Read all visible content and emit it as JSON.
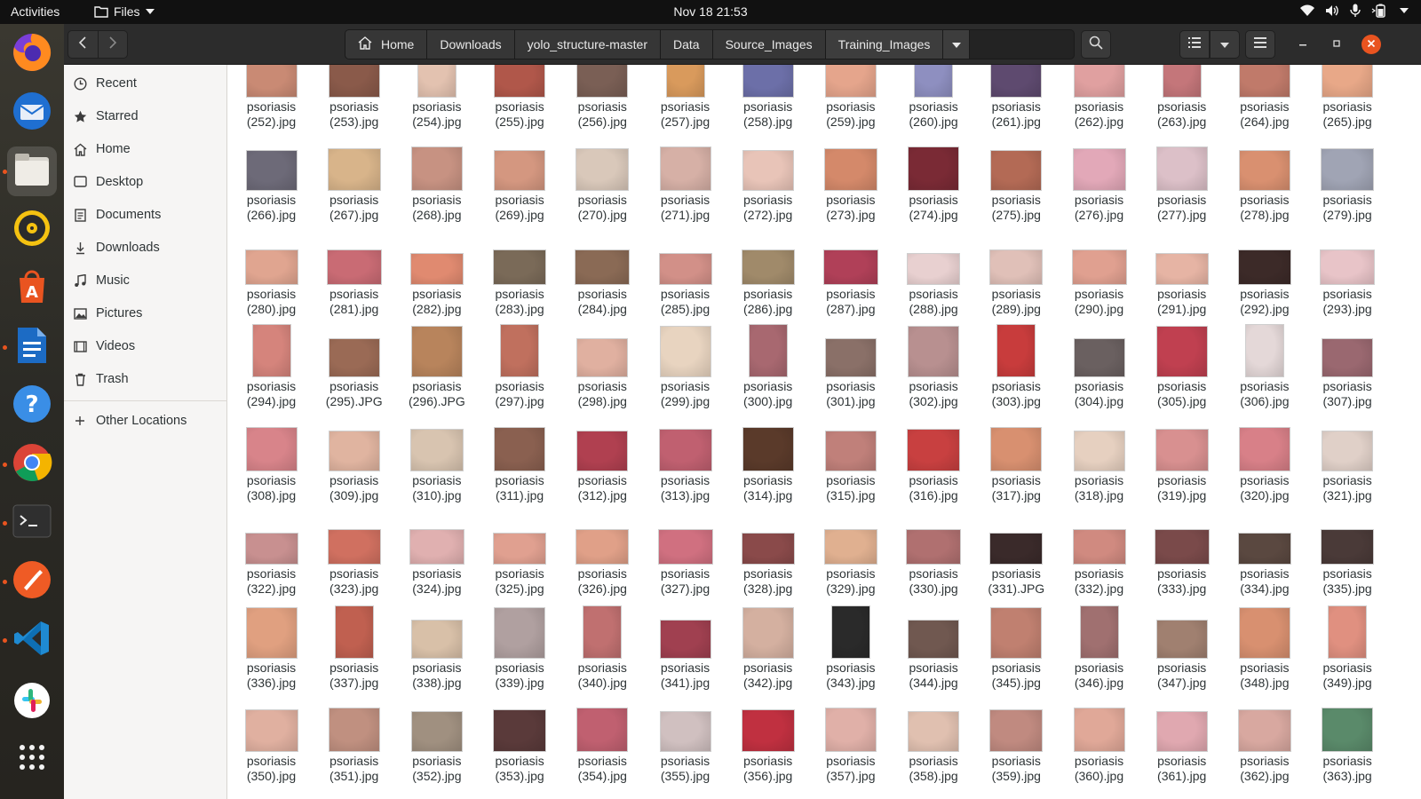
{
  "topbar": {
    "activities": "Activities",
    "app_name": "Files",
    "clock": "Nov 18  21:53"
  },
  "dock": {
    "items": [
      {
        "name": "firefox-icon",
        "running": false
      },
      {
        "name": "thunderbird-icon",
        "running": false
      },
      {
        "name": "files-icon",
        "running": true
      },
      {
        "name": "rhythmbox-icon",
        "running": false
      },
      {
        "name": "software-center-icon",
        "running": false
      },
      {
        "name": "libreoffice-writer-icon",
        "running": true
      },
      {
        "name": "help-icon",
        "running": false
      },
      {
        "name": "chrome-icon",
        "running": true
      },
      {
        "name": "terminal-icon",
        "running": true
      },
      {
        "name": "postman-icon",
        "running": true
      },
      {
        "name": "vscode-icon",
        "running": true
      },
      {
        "name": "slack-icon",
        "running": false
      },
      {
        "name": "show-apps-icon",
        "running": false
      }
    ]
  },
  "pathbar": {
    "home": "Home",
    "crumbs": [
      "Downloads",
      "yolo_structure-master",
      "Data",
      "Source_Images",
      "Training_Images"
    ]
  },
  "sidebar": {
    "items": [
      {
        "label": "Recent",
        "icon": "clock-icon"
      },
      {
        "label": "Starred",
        "icon": "star-icon"
      },
      {
        "label": "Home",
        "icon": "home-icon"
      },
      {
        "label": "Desktop",
        "icon": "desktop-icon"
      },
      {
        "label": "Documents",
        "icon": "documents-icon"
      },
      {
        "label": "Downloads",
        "icon": "downloads-icon"
      },
      {
        "label": "Music",
        "icon": "music-icon"
      },
      {
        "label": "Pictures",
        "icon": "pictures-icon"
      },
      {
        "label": "Videos",
        "icon": "videos-icon"
      },
      {
        "label": "Trash",
        "icon": "trash-icon"
      }
    ],
    "other_locations": "Other Locations"
  },
  "files": {
    "prefix": "psoriasis",
    "rows": [
      [
        "(252).jpg",
        "(253).jpg",
        "(254).jpg",
        "(255).jpg",
        "(256).jpg",
        "(257).jpg",
        "(258).jpg",
        "(259).jpg",
        "(260).jpg",
        "(261).jpg",
        "(262).jpg",
        "(263).jpg",
        "(264).jpg",
        "(265).jpg"
      ],
      [
        "(266).jpg",
        "(267).jpg",
        "(268).jpg",
        "(269).jpg",
        "(270).jpg",
        "(271).jpg",
        "(272).jpg",
        "(273).jpg",
        "(274).jpg",
        "(275).jpg",
        "(276).jpg",
        "(277).jpg",
        "(278).jpg",
        "(279).jpg"
      ],
      [
        "(280).jpg",
        "(281).jpg",
        "(282).jpg",
        "(283).jpg",
        "(284).jpg",
        "(285).jpg",
        "(286).jpg",
        "(287).jpg",
        "(288).jpg",
        "(289).jpg",
        "(290).jpg",
        "(291).jpg",
        "(292).jpg",
        "(293).jpg"
      ],
      [
        "(294).jpg",
        "(295).JPG",
        "(296).JPG",
        "(297).jpg",
        "(298).jpg",
        "(299).jpg",
        "(300).jpg",
        "(301).jpg",
        "(302).jpg",
        "(303).jpg",
        "(304).jpg",
        "(305).jpg",
        "(306).jpg",
        "(307).jpg"
      ],
      [
        "(308).jpg",
        "(309).jpg",
        "(310).jpg",
        "(311).jpg",
        "(312).jpg",
        "(313).jpg",
        "(314).jpg",
        "(315).jpg",
        "(316).jpg",
        "(317).jpg",
        "(318).jpg",
        "(319).jpg",
        "(320).jpg",
        "(321).jpg"
      ],
      [
        "(322).jpg",
        "(323).jpg",
        "(324).jpg",
        "(325).jpg",
        "(326).jpg",
        "(327).jpg",
        "(328).jpg",
        "(329).jpg",
        "(330).jpg",
        "(331).JPG",
        "(332).jpg",
        "(333).jpg",
        "(334).jpg",
        "(335).jpg"
      ],
      [
        "(336).jpg",
        "(337).jpg",
        "(338).jpg",
        "(339).jpg",
        "(340).jpg",
        "(341).jpg",
        "(342).jpg",
        "(343).jpg",
        "(344).jpg",
        "(345).jpg",
        "(346).jpg",
        "(347).jpg",
        "(348).jpg",
        "(349).jpg"
      ],
      [
        "(350).jpg",
        "(351).jpg",
        "(352).jpg",
        "(353).jpg",
        "(354).jpg",
        "(355).jpg",
        "(356).jpg",
        "(357).jpg",
        "(358).jpg",
        "(359).jpg",
        "(360).jpg",
        "(361).jpg",
        "(362).jpg",
        "(363).jpg"
      ]
    ],
    "colors": [
      [
        "#c98a74",
        "#8a5a4a",
        "#e3c2b0",
        "#b0574a",
        "#7a5f55",
        "#d99a5c",
        "#6c6fa8",
        "#e5a58c",
        "#8e8fc0",
        "#5e4a6f",
        "#e0a0a0",
        "#c4767a",
        "#c07a6a",
        "#e8a888"
      ],
      [
        "#6d6a78",
        "#d8b48a",
        "#c79282",
        "#d49780",
        "#d9c8ba",
        "#d6b0a6",
        "#e8c4b8",
        "#d4896a",
        "#7a2a35",
        "#b36a55",
        "#e2a8b8",
        "#dcc0c8",
        "#d99070",
        "#a0a4b4"
      ],
      [
        "#e0a590",
        "#c96b74",
        "#e08a70",
        "#7a6a58",
        "#8a6a55",
        "#d29088",
        "#a08a6a",
        "#b04058",
        "#e8d0d0",
        "#e0c0b8",
        "#e0a090",
        "#e6b4a4",
        "#3c2a28",
        "#e8c4c8"
      ],
      [
        "#d5847c",
        "#9a6a55",
        "#b8845c",
        "#c0705e",
        "#e0b0a0",
        "#e8d4c0",
        "#a86870",
        "#8a7068",
        "#b89090",
        "#c83c3c",
        "#6a6060",
        "#c04050",
        "#e4d8d8",
        "#9a6870"
      ],
      [
        "#d8848a",
        "#e0b4a0",
        "#d8c4b0",
        "#8a6050",
        "#b04050",
        "#c06070",
        "#5a3a2a",
        "#c0807a",
        "#c84040",
        "#d89070",
        "#e6d0c0",
        "#d89090",
        "#d88088",
        "#e0d0c8"
      ],
      [
        "#c89090",
        "#d07060",
        "#e0b0b0",
        "#e0a090",
        "#e0a088",
        "#d07080",
        "#8a4a4a",
        "#e0b090",
        "#b07070",
        "#3a2a2a",
        "#d08a80",
        "#7a4a4a",
        "#5a4840",
        "#4a3a38"
      ],
      [
        "#e0a080",
        "#c06050",
        "#d8c0a8",
        "#b0a0a0",
        "#c07070",
        "#a04050",
        "#d4b0a0",
        "#2a2a2a",
        "#705850",
        "#c08070",
        "#a07070",
        "#a08070",
        "#d89070",
        "#e09080"
      ],
      [
        "#e0b0a0",
        "#c09080",
        "#a09080",
        "#5a3a3a",
        "#c06070",
        "#d0c0c0",
        "#c03040",
        "#e0b0a8",
        "#e0c0b0",
        "#c08a80",
        "#e0a898",
        "#e0a8b0",
        "#d8a8a0",
        "#5a8a6a"
      ]
    ]
  }
}
